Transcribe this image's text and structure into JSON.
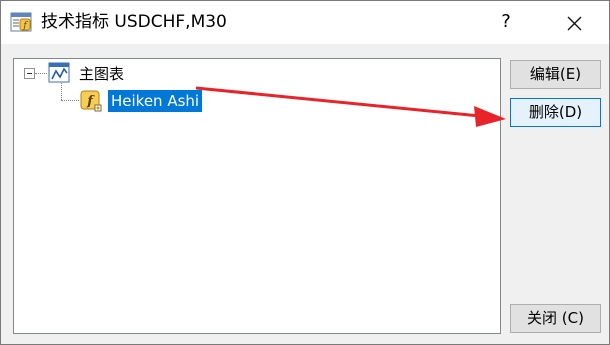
{
  "window": {
    "title": "技术指标 USDCHF,M30",
    "help_glyph": "?",
    "close_icon": "close-icon"
  },
  "tree": {
    "root_label": "主图表",
    "root_icon": "chart-window-icon",
    "children": [
      {
        "label": "Heiken Ashi",
        "icon": "custom-indicator-fx-icon",
        "selected": true
      }
    ]
  },
  "buttons": {
    "edit_label": "编辑(E)",
    "delete_label": "删除(D)",
    "close_label": "关闭 (C)"
  },
  "colors": {
    "selection": "#0078d7",
    "annotation_arrow": "#e8242a",
    "dialog_bg": "#f0f0f0"
  }
}
